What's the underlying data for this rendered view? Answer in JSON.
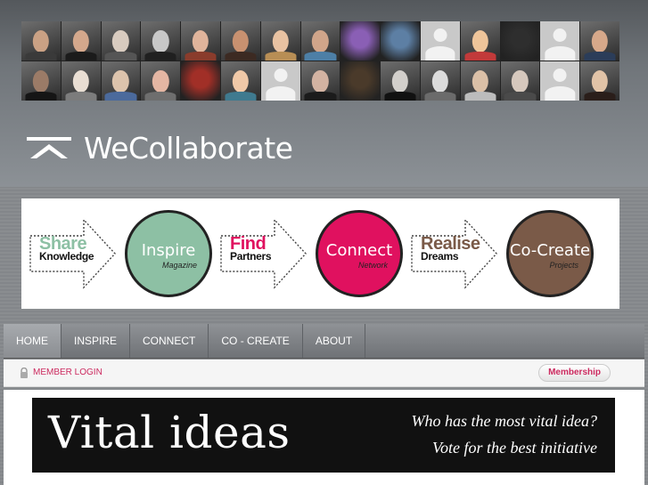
{
  "brand": {
    "name": "WeCollaborate"
  },
  "photo_wall": {
    "rows": [
      [
        {
          "type": "face",
          "skin": "#caa184",
          "cloth": "#3a3a3a"
        },
        {
          "type": "face",
          "skin": "#d4a88c",
          "cloth": "#1b1b1b"
        },
        {
          "type": "face",
          "skin": "#d8cbbf",
          "cloth": "#555555"
        },
        {
          "type": "face",
          "skin": "#c8c8c8",
          "cloth": "#202020"
        },
        {
          "type": "face",
          "skin": "#e0b49b",
          "cloth": "#8a3c2c"
        },
        {
          "type": "face",
          "skin": "#c89170",
          "cloth": "#3c2a22"
        },
        {
          "type": "face",
          "skin": "#e8c2a2",
          "cloth": "#b88e55"
        },
        {
          "type": "face",
          "skin": "#d0a58a",
          "cloth": "#4d7fa6"
        },
        {
          "type": "flower",
          "color": "#8a5fb5"
        },
        {
          "type": "landscape",
          "color": "#5d7fa4"
        },
        {
          "type": "silhouette"
        },
        {
          "type": "face",
          "skin": "#efc59a",
          "cloth": "#c23a3a"
        },
        {
          "type": "landscape",
          "color": "#2e2e2e"
        },
        {
          "type": "silhouette"
        },
        {
          "type": "face",
          "skin": "#d6a88a",
          "cloth": "#2b3d59"
        }
      ],
      [
        {
          "type": "face",
          "skin": "#9b7b67",
          "cloth": "#151515"
        },
        {
          "type": "face",
          "skin": "#e9ded3",
          "cloth": "#7c7c7c"
        },
        {
          "type": "face",
          "skin": "#dcc3ac",
          "cloth": "#4b6a9c"
        },
        {
          "type": "face",
          "skin": "#e4b6a3",
          "cloth": "#6e6e6e"
        },
        {
          "type": "flower",
          "color": "#a12f27"
        },
        {
          "type": "face",
          "skin": "#f0c9a8",
          "cloth": "#3f7a8f"
        },
        {
          "type": "silhouette"
        },
        {
          "type": "face",
          "skin": "#d3b3a2",
          "cloth": "#1b1b1b"
        },
        {
          "type": "landscape",
          "color": "#4a3a2a"
        },
        {
          "type": "face",
          "skin": "#d2cfcb",
          "cloth": "#111111"
        },
        {
          "type": "face",
          "skin": "#dcdcdc",
          "cloth": "#6b6b6b"
        },
        {
          "type": "face",
          "skin": "#dbc0a7",
          "cloth": "#bcbcbc"
        },
        {
          "type": "face",
          "skin": "#d6c8bd",
          "cloth": "#4a4a4a"
        },
        {
          "type": "silhouette"
        },
        {
          "type": "face",
          "skin": "#e1c3a7",
          "cloth": "#2a1e1a"
        }
      ]
    ]
  },
  "banner": {
    "steps": [
      {
        "arrow_big": "Share",
        "arrow_small": "Knowledge",
        "arrow_color": "#8dc0a4",
        "circle_title": "Inspire",
        "circle_sub": "Magazine",
        "circle_color": "#8dc0a4"
      },
      {
        "arrow_big": "Find",
        "arrow_small": "Partners",
        "arrow_color": "#e0115f",
        "circle_title": "Connect",
        "circle_sub": "Network",
        "circle_color": "#e0115f"
      },
      {
        "arrow_big": "Realise",
        "arrow_small": "Dreams",
        "arrow_color": "#7a5a48",
        "circle_title": "Co-Create",
        "circle_sub": "Projects",
        "circle_color": "#7a5a48"
      }
    ]
  },
  "nav": {
    "items": [
      {
        "label": "HOME",
        "active": true
      },
      {
        "label": "INSPIRE",
        "active": false
      },
      {
        "label": "CONNECT",
        "active": false
      },
      {
        "label": "CO - CREATE",
        "active": false
      },
      {
        "label": "ABOUT",
        "active": false
      }
    ]
  },
  "login_bar": {
    "member_login": "MEMBER LOGIN",
    "membership": "Membership"
  },
  "vital_banner": {
    "title": "Vital ideas",
    "line1": "Who has the most vital idea?",
    "line2": "Vote for the best initiative"
  }
}
